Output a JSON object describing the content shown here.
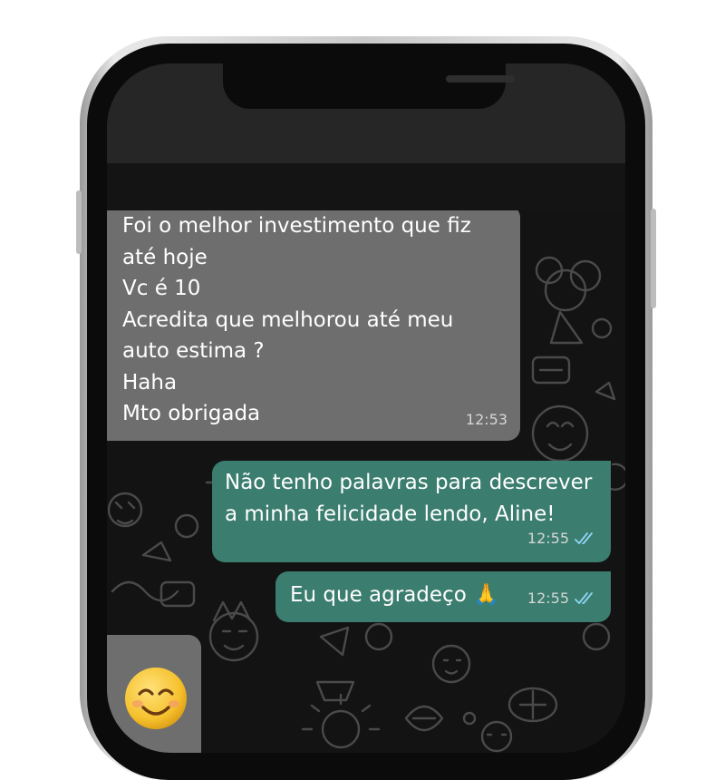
{
  "incoming": {
    "lines": [
      "Foi o melhor investimento que fiz",
      "até hoje",
      "Vc é 10",
      "Acredita que melhorou até meu",
      "auto estima ?",
      "Haha",
      "Mto obrigada"
    ],
    "time": "12:53"
  },
  "outgoing": [
    {
      "lines": [
        "Não tenho palavras para descrever",
        "a minha felicidade lendo, Aline!"
      ],
      "time": "12:55",
      "status_icon": "double-check-icon"
    },
    {
      "text": "Eu que agradeço 🙏",
      "time": "12:55",
      "status_icon": "double-check-icon"
    }
  ],
  "sticker": {
    "icon": "smiling-face-emoji"
  },
  "colors": {
    "incoming_bubble": "#6e6e6e",
    "outgoing_bubble": "#3b7d6e",
    "chat_background": "#131313",
    "read_ticks": "#8fd4f5"
  }
}
